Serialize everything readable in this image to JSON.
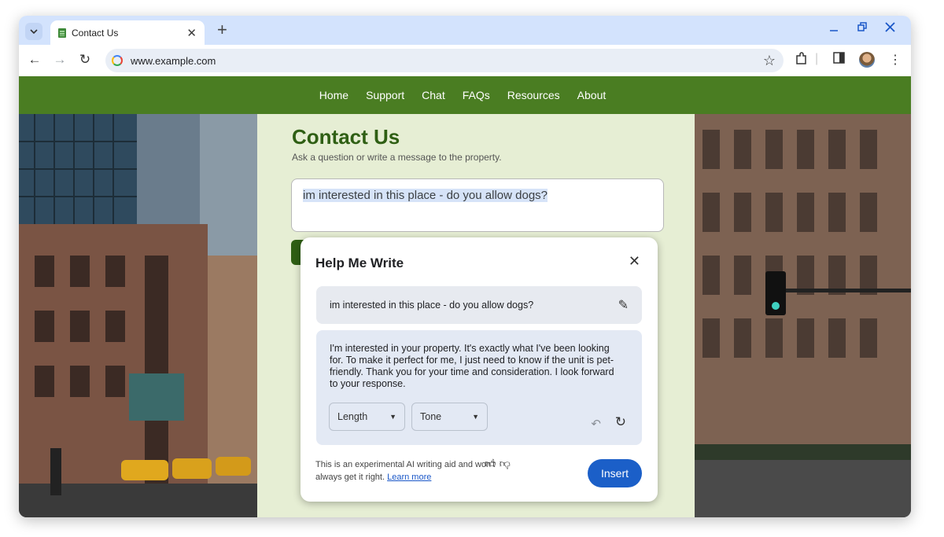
{
  "browser": {
    "tab_title": "Contact Us",
    "new_tab_symbol": "+",
    "url": "www.example.com"
  },
  "site_nav": {
    "items": [
      "Home",
      "Support",
      "Chat",
      "FAQs",
      "Resources",
      "About"
    ]
  },
  "contact": {
    "title": "Contact Us",
    "subtitle": "Ask a question or write a message to the property.",
    "message": "im interested in this place - do you allow dogs?"
  },
  "help_me_write": {
    "title": "Help Me Write",
    "prompt": "im interested in this place - do you allow dogs?",
    "result": "I'm interested in your property. It's exactly what I've been looking for. To make it perfect for me, I just need to know if the unit is pet-friendly. Thank you for your time and consideration. I look forward to your response.",
    "length_label": "Length",
    "tone_label": "Tone",
    "disclaimer_text": "This is an experimental AI writing aid and won't always get it right.",
    "learn_more": "Learn more",
    "insert_label": "Insert"
  },
  "colors": {
    "site_green": "#4a7d22",
    "panel_bg": "#e6eed4",
    "insert_blue": "#1b5fc8"
  }
}
